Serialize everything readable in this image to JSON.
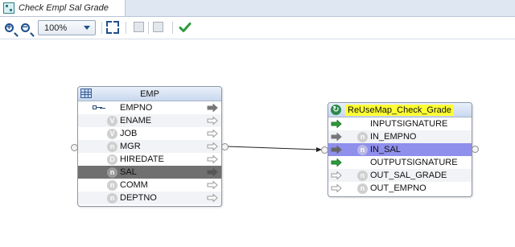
{
  "tab": {
    "title": "Check Empl Sal Grade",
    "icon": "mapping-icon",
    "close": "×"
  },
  "toolbar": {
    "zoom_value": "100%",
    "zoom_in_sign": "+",
    "zoom_out_sign": "−"
  },
  "emp_node": {
    "title": "EMP",
    "icon": "table-icon",
    "fields": [
      {
        "name": "EMPNO",
        "icon": "key-icon",
        "selected": false
      },
      {
        "name": "ENAME",
        "icon": "varchar-icon",
        "type_glyph": "V",
        "selected": false
      },
      {
        "name": "JOB",
        "icon": "varchar-icon",
        "type_glyph": "V",
        "selected": false
      },
      {
        "name": "MGR",
        "icon": "number-icon",
        "type_glyph": "n",
        "selected": false
      },
      {
        "name": "HIREDATE",
        "icon": "date-icon",
        "type_glyph": "D",
        "selected": false
      },
      {
        "name": "SAL",
        "icon": "number-icon",
        "type_glyph": "n",
        "selected": true
      },
      {
        "name": "COMM",
        "icon": "number-icon",
        "type_glyph": "n",
        "selected": false
      },
      {
        "name": "DEPTNO",
        "icon": "number-icon",
        "type_glyph": "n",
        "selected": false
      }
    ]
  },
  "reuse_node": {
    "title": "ReUseMap_Check_Grade",
    "icon": "reusable-mapping-icon",
    "rows": [
      {
        "name": "INPUTSIGNATURE",
        "kind": "group",
        "icon": "input-group-icon"
      },
      {
        "name": "IN_EMPNO",
        "kind": "attr",
        "type_glyph": "n",
        "selected": false
      },
      {
        "name": "IN_SAL",
        "kind": "attr",
        "type_glyph": "n",
        "selected": true
      },
      {
        "name": "OUTPUTSIGNATURE",
        "kind": "group",
        "icon": "output-group-icon"
      },
      {
        "name": "OUT_SAL_GRADE",
        "kind": "attr",
        "type_glyph": "n",
        "selected": false
      },
      {
        "name": "OUT_EMPNO",
        "kind": "attr",
        "type_glyph": "n",
        "selected": false
      }
    ]
  },
  "colors": {
    "selected_emp_row": "#707070",
    "selected_reuse_row": "#8f8fec",
    "title_highlight": "#ffff33",
    "header_gradient_top": "#e9f0fa",
    "header_gradient_bottom": "#c9d8ee",
    "accent_green": "#2d8a4a"
  }
}
